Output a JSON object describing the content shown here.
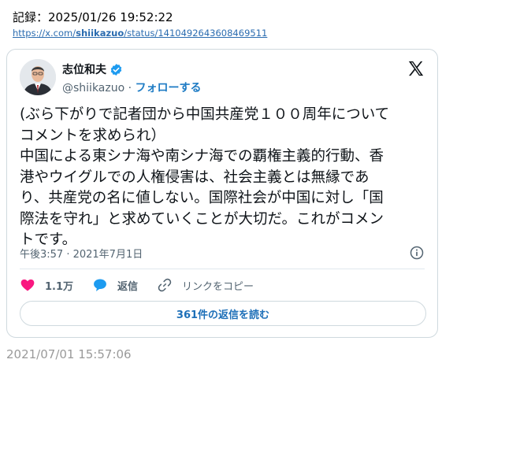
{
  "record": {
    "label": "記録：2025/01/26 19:52:22",
    "url_prefix": "https://x.com/",
    "url_user": "shiikazuo",
    "url_suffix": "/status/1410492643608469511"
  },
  "tweet": {
    "author_name": "志位和夫",
    "handle": "@shiikazuo",
    "separator": " · ",
    "follow_label": "フォローする",
    "text": "(ぶら下がりで記者団から中国共産党１００周年について\nコメントを求められ）\n中国による東シナ海や南シナ海での覇権主義的行動、香\n港やウイグルでの人権侵害は、社会主義とは無縁であ\nり、共産党の名に値しない。国際社会が中国に対し「国\n際法を守れ」と求めていくことが大切だ。これがコメン\nトです。",
    "timestamp": "午後3:57 · 2021年7月1日",
    "likes": "1.1万",
    "reply_label": "返信",
    "copy_link_label": "リンクをコピー",
    "read_replies_label": "361件の返信を読む"
  },
  "bottom_timestamp": "2021/07/01 15:57:06",
  "colors": {
    "link": "#2b6cb0",
    "follow": "#1d7bc4",
    "like": "#f91880",
    "reply_bubble": "#1d9bf0",
    "verified": "#1d9bf0"
  }
}
